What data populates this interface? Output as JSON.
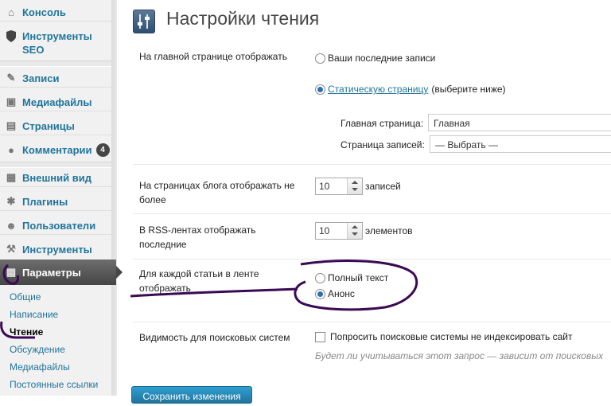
{
  "sidebar": {
    "items": [
      {
        "label": "Консоль",
        "icon": "dashboard-icon"
      },
      {
        "label": "Инструменты SEO",
        "icon": "seo-shield-icon"
      },
      {
        "label": "Записи",
        "icon": "pin-icon"
      },
      {
        "label": "Медиафайлы",
        "icon": "media-icon"
      },
      {
        "label": "Страницы",
        "icon": "pages-icon"
      },
      {
        "label": "Комментарии",
        "icon": "comment-icon",
        "badge": "4"
      },
      {
        "label": "Внешний вид",
        "icon": "appearance-icon"
      },
      {
        "label": "Плагины",
        "icon": "plugin-icon"
      },
      {
        "label": "Пользователи",
        "icon": "users-icon"
      },
      {
        "label": "Инструменты",
        "icon": "tools-icon"
      },
      {
        "label": "Параметры",
        "icon": "settings-icon"
      }
    ],
    "submenu": [
      "Общие",
      "Написание",
      "Чтение",
      "Обсуждение",
      "Медиафайлы",
      "Постоянные ссылки"
    ]
  },
  "page": {
    "title": "Настройки чтения"
  },
  "front": {
    "label": "На главной странице отображать",
    "opt_latest": "Ваши последние записи",
    "opt_static_link": "Статическую страницу",
    "opt_static_rest": "(выберите ниже)",
    "home_label": "Главная страница:",
    "home_value": "Главная",
    "posts_label": "Страница записей:",
    "posts_value": "— Выбрать —"
  },
  "blog": {
    "label": "На страницах блога отображать не более",
    "value": "10",
    "unit": "записей"
  },
  "rss": {
    "label": "В RSS-лентах отображать последние",
    "value": "10",
    "unit": "элементов"
  },
  "feed": {
    "label": "Для каждой статьи в ленте отображать",
    "opt_full": "Полный текст",
    "opt_summary": "Анонс"
  },
  "visibility": {
    "label": "Видимость для поисковых систем",
    "checkbox": "Попросить поисковые системы не индексировать сайт",
    "hint": "Будет ли учитываться этот запрос — зависит от поисковых"
  },
  "save_label": "Сохранить изменения",
  "colors": {
    "accent": "#21759b",
    "annotation": "#3b0a55"
  }
}
